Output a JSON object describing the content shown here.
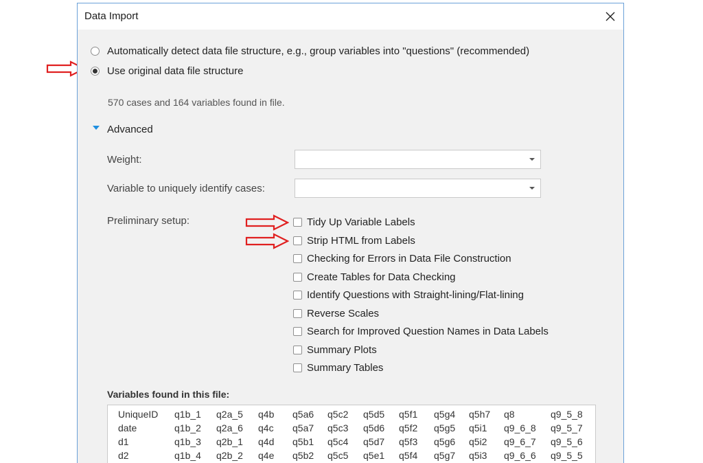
{
  "dialog": {
    "title": "Data Import",
    "close_icon": "close-icon"
  },
  "structure": {
    "options": [
      {
        "label": "Automatically detect data file structure, e.g., group variables into \"questions\" (recommended)",
        "selected": false
      },
      {
        "label": "Use original data file structure",
        "selected": true
      }
    ]
  },
  "info_text": "570 cases and 164 variables found in file.",
  "advanced": {
    "label": "Advanced",
    "expanded": true,
    "weight_label": "Weight:",
    "weight_value": "",
    "identify_label": "Variable to uniquely identify cases:",
    "identify_value": "",
    "setup_label": "Preliminary setup:",
    "setup_options": [
      {
        "label": "Tidy Up Variable Labels",
        "checked": false
      },
      {
        "label": "Strip HTML from Labels",
        "checked": false
      },
      {
        "label": "Checking for Errors in Data File Construction",
        "checked": false
      },
      {
        "label": "Create Tables for Data Checking",
        "checked": false
      },
      {
        "label": "Identify Questions with Straight-lining/Flat-lining",
        "checked": false
      },
      {
        "label": "Reverse Scales",
        "checked": false
      },
      {
        "label": "Search for Improved Question Names in Data Labels",
        "checked": false
      },
      {
        "label": "Summary Plots",
        "checked": false
      },
      {
        "label": "Summary Tables",
        "checked": false
      }
    ]
  },
  "variables": {
    "label": "Variables found in this file:",
    "rows": [
      [
        "UniqueID",
        "q1b_1",
        "q2a_5",
        "q4b",
        "q5a6",
        "q5c2",
        "q5d5",
        "q5f1",
        "q5g4",
        "q5h7",
        "q8",
        "q9_5_8"
      ],
      [
        "date",
        "q1b_2",
        "q2a_6",
        "q4c",
        "q5a7",
        "q5c3",
        "q5d6",
        "q5f2",
        "q5g5",
        "q5i1",
        "q9_6_8",
        "q9_5_7"
      ],
      [
        "d1",
        "q1b_3",
        "q2b_1",
        "q4d",
        "q5b1",
        "q5c4",
        "q5d7",
        "q5f3",
        "q5g6",
        "q5i2",
        "q9_6_7",
        "q9_5_6"
      ],
      [
        "d2",
        "q1b_4",
        "q2b_2",
        "q4e",
        "q5b2",
        "q5c5",
        "q5e1",
        "q5f4",
        "q5g7",
        "q5i3",
        "q9_6_6",
        "q9_5_5"
      ]
    ]
  },
  "annotations": {
    "arrow_color": "#e02020"
  },
  "colors": {
    "dialog_border": "#6aa0d8",
    "dialog_bg": "#f1f1f1",
    "accent": "#1f8fe0"
  }
}
